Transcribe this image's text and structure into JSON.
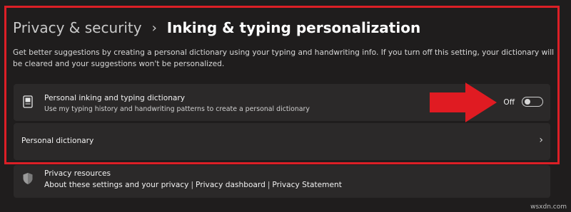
{
  "breadcrumb": {
    "parent": "Privacy & security",
    "separator": "›",
    "current": "Inking & typing personalization"
  },
  "description": "Get better suggestions by creating a personal dictionary using your typing and handwriting info. If you turn off this setting, your dictionary will be cleared and your suggestions won't be personalized.",
  "dictionary_setting": {
    "icon": "notebook-icon",
    "title": "Personal inking and typing dictionary",
    "subtitle": "Use my typing history and handwriting patterns to create a personal dictionary",
    "state_label": "Off",
    "enabled": false
  },
  "personal_dictionary": {
    "label": "Personal dictionary",
    "chevron": "›"
  },
  "privacy_resources": {
    "icon": "shield-icon",
    "title": "Privacy resources",
    "links": [
      "About these settings and your privacy",
      "Privacy dashboard",
      "Privacy Statement"
    ],
    "separator": "|"
  },
  "annotation": {
    "highlight_color": "#dc1f26"
  },
  "watermark": "wsxdn.com"
}
